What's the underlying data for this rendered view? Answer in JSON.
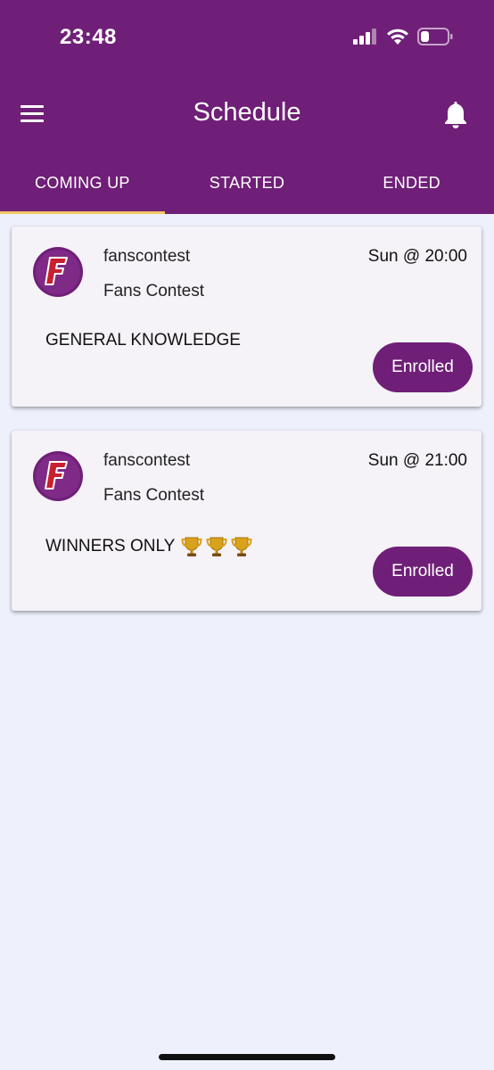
{
  "status_bar": {
    "time": "23:48"
  },
  "header": {
    "title": "Schedule"
  },
  "tabs": [
    {
      "label": "COMING UP",
      "active": true
    },
    {
      "label": "STARTED",
      "active": false
    },
    {
      "label": "ENDED",
      "active": false
    }
  ],
  "events": [
    {
      "username": "fanscontest",
      "display_name": "Fans Contest",
      "when": "Sun @ 20:00",
      "name": "GENERAL KNOWLEDGE",
      "trophies": 0,
      "status_label": "Enrolled"
    },
    {
      "username": "fanscontest",
      "display_name": "Fans Contest",
      "when": "Sun @ 21:00",
      "name": "WINNERS ONLY",
      "trophies": 3,
      "status_label": "Enrolled"
    }
  ],
  "colors": {
    "primary": "#6f1f77",
    "tab_indicator": "#f3c768",
    "background": "#eef1fc",
    "card": "#f5f2f8"
  }
}
